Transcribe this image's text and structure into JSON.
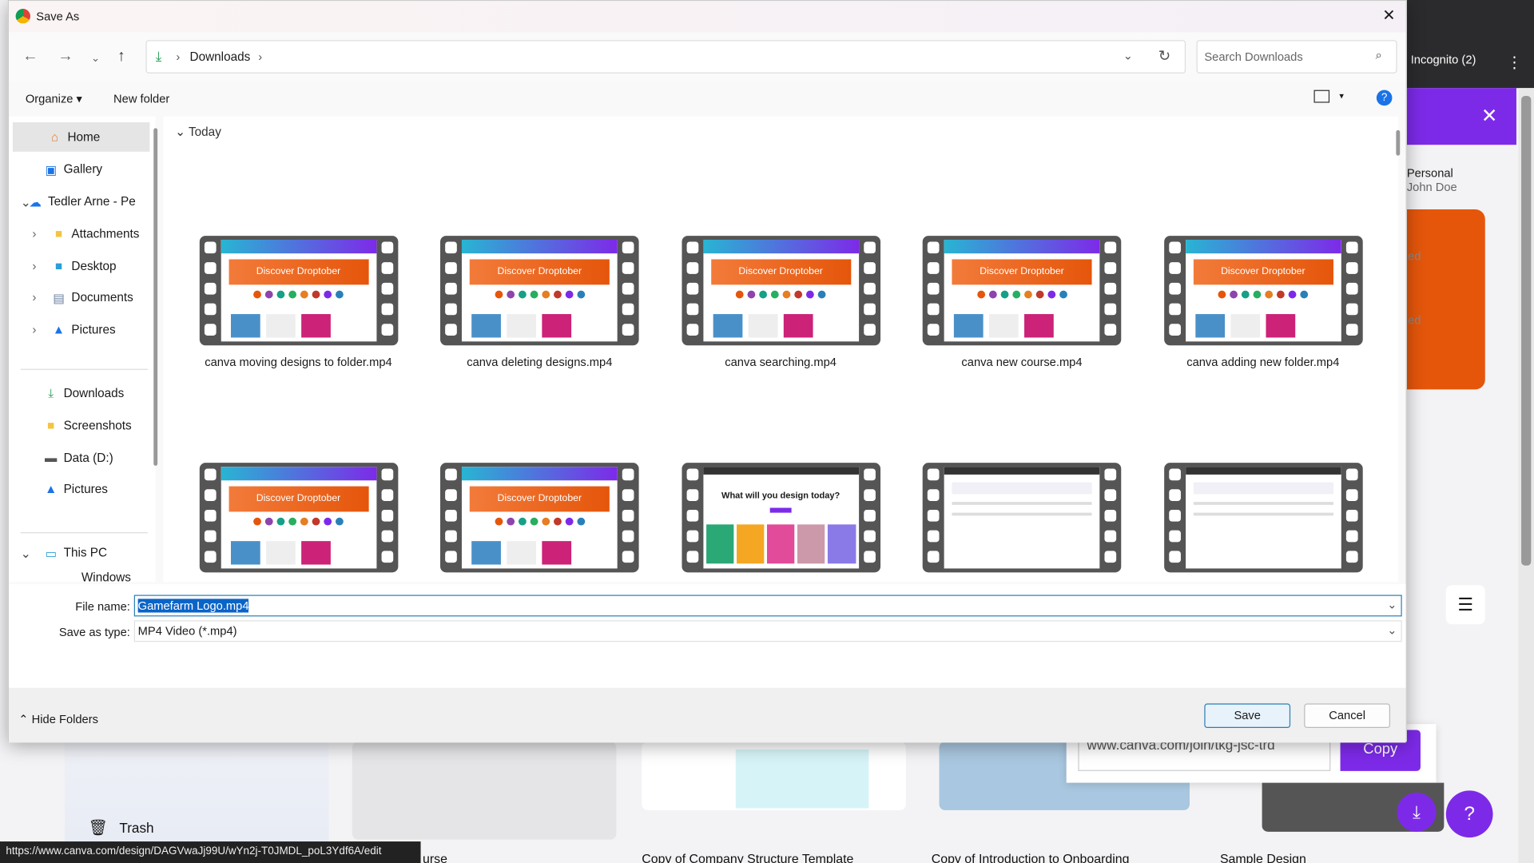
{
  "background": {
    "incognito": "Incognito (2)",
    "account_type": "Personal",
    "account_name": "John Doe",
    "share_link": "www.canva.com/join/tkg-jsc-trd",
    "copy_label": "Copy",
    "trash_label": "Trash",
    "status_url": "https://www.canva.com/design/DAGVwaJj99U/wYn2j-T0JMDL_poL3Ydf6A/edit",
    "cards": [
      "urse",
      "Copy of Company Structure Template",
      "Copy of Introduction to Onboarding",
      "Sample Design"
    ],
    "partial_left_1": "ed",
    "partial_left_2": "ed",
    "accent": "#7d2ae8"
  },
  "dialog": {
    "title": "Save As",
    "breadcrumb": [
      "Downloads"
    ],
    "search_placeholder": "Search Downloads",
    "toolbar": {
      "organize": "Organize",
      "new_folder": "New folder",
      "help": "?"
    },
    "sidebar": [
      {
        "label": "Home",
        "icon": "home-icon",
        "selected": true
      },
      {
        "label": "Gallery",
        "icon": "gallery-icon"
      },
      {
        "label": "Tedler Arne - Pe",
        "icon": "onedrive-icon",
        "expanded": true
      },
      {
        "label": "Attachments",
        "icon": "folder-icon"
      },
      {
        "label": "Desktop",
        "icon": "desktop-icon"
      },
      {
        "label": "Documents",
        "icon": "documents-icon"
      },
      {
        "label": "Pictures",
        "icon": "pictures-icon"
      },
      {
        "label": "Downloads",
        "icon": "download-icon"
      },
      {
        "label": "Screenshots",
        "icon": "folder-icon"
      },
      {
        "label": "Data (D:)",
        "icon": "drive-icon"
      },
      {
        "label": "Pictures",
        "icon": "pictures-icon"
      },
      {
        "label": "This PC",
        "icon": "pc-icon",
        "expanded": true
      },
      {
        "label": "Windows (C:)",
        "icon": "drive-icon"
      }
    ],
    "group": "Today",
    "files": [
      {
        "name": "canva moving designs to folder.mp4",
        "thumb": "Discover Droptober"
      },
      {
        "name": "canva deleting designs.mp4",
        "thumb": "Discover Droptober"
      },
      {
        "name": "canva searching.mp4",
        "thumb": "Discover Droptober"
      },
      {
        "name": "canva new course.mp4",
        "thumb": "Discover Droptober"
      },
      {
        "name": "canva adding new folder.mp4",
        "thumb": "Discover Droptober"
      },
      {
        "name": "",
        "thumb": "Discover Droptober"
      },
      {
        "name": "",
        "thumb": "Discover Droptober"
      },
      {
        "name": "",
        "thumb": "What will you design today?"
      },
      {
        "name": "",
        "thumb": ""
      },
      {
        "name": "",
        "thumb": ""
      }
    ],
    "file_name_label": "File name:",
    "file_name": "Gamefarm Logo.mp4",
    "save_type_label": "Save as type:",
    "save_type": "MP4 Video (*.mp4)",
    "hide_folders": "Hide Folders",
    "save": "Save",
    "cancel": "Cancel"
  }
}
